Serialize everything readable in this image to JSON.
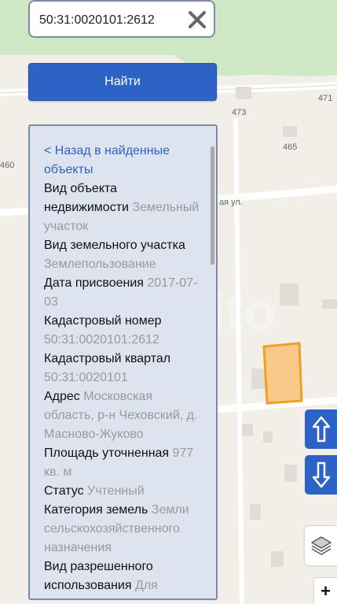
{
  "search": {
    "value": "50:31:0020101:2612"
  },
  "find_button_label": "Найти",
  "panel": {
    "back_link": "< Назад в найденные объекты",
    "fields": [
      {
        "label": "Вид объекта недвижимости",
        "value": "Земельный участок"
      },
      {
        "label": "Вид земельного участка",
        "value": "Землепользование"
      },
      {
        "label": "Дата присвоения",
        "value": "2017-07-03"
      },
      {
        "label": "Кадастровый номер",
        "value": "50:31:0020101:2612"
      },
      {
        "label": "Кадастровый квартал",
        "value": "50:31:0020101"
      },
      {
        "label": "Адрес",
        "value": "Московская область, р-н Чеховский, д. Масново-Жуково"
      },
      {
        "label": "Площадь уточненная",
        "value": "977 кв. м"
      },
      {
        "label": "Статус",
        "value": "Учтенный"
      },
      {
        "label": "Категория земель",
        "value": "Земли сельскохозяйственного назначения"
      },
      {
        "label": "Вид разрешенного использования",
        "value": "Для"
      }
    ]
  },
  "map": {
    "labels": {
      "house_473": "473",
      "house_471": "471",
      "house_465": "465",
      "house_460": "460",
      "street": "ая ул."
    },
    "colors": {
      "background": "#f2efe9",
      "forest": "#cfe8c4",
      "building": "#e1dcd4",
      "highlight_fill": "#f9c98a",
      "highlight_stroke": "#f0a020"
    },
    "watermark": "Avito"
  },
  "controls": {
    "up_icon": "arrow-up-icon",
    "down_icon": "arrow-down-icon",
    "layers_icon": "layers-icon",
    "zoom_in": "+"
  },
  "accent_color": "#2e63c6"
}
